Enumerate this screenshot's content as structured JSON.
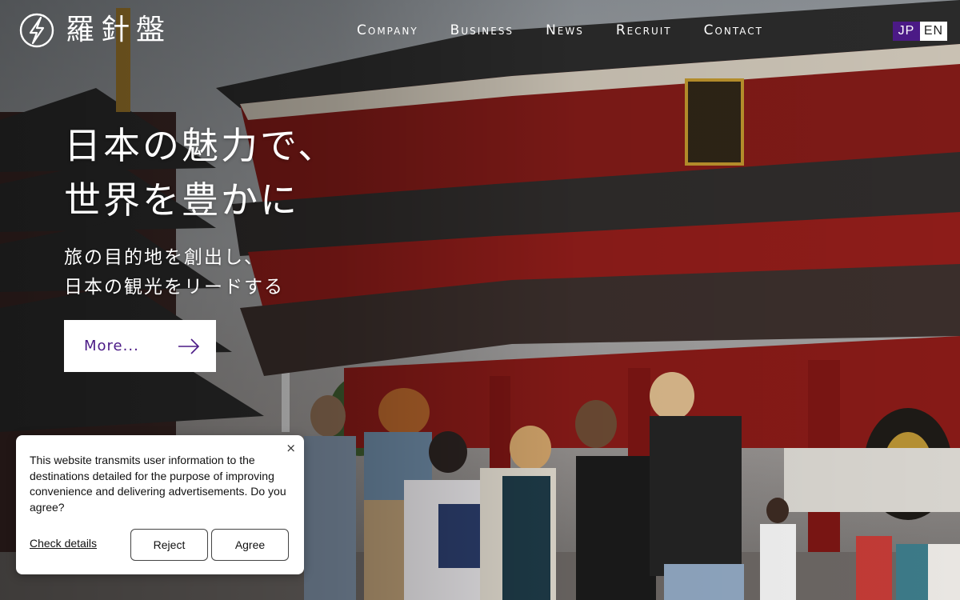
{
  "header": {
    "logo_text": "羅針盤",
    "nav": [
      {
        "label": "Company"
      },
      {
        "label": "Business"
      },
      {
        "label": "News"
      },
      {
        "label": "Recruit"
      },
      {
        "label": "Contact"
      }
    ],
    "lang": {
      "jp": "JP",
      "en": "EN",
      "active": "JP"
    }
  },
  "hero": {
    "headline_line1": "日本の魅力で、",
    "headline_line2": "世界を豊かに",
    "sub_line1": "旅の目的地を創出し、",
    "sub_line2": "日本の観光をリードする",
    "more_label": "More..."
  },
  "cookie_banner": {
    "message": "This website transmits user information to the destinations detailed for the purpose of improving convenience and delivering advertisements. Do you agree?",
    "close": "×",
    "check_details": "Check details",
    "reject": "Reject",
    "agree": "Agree"
  },
  "colors": {
    "accent": "#4b1a86",
    "temple_red": "#8e1d1a",
    "white": "#ffffff"
  },
  "icons": [
    "compass-logo-icon",
    "arrow-right-icon",
    "close-icon"
  ]
}
